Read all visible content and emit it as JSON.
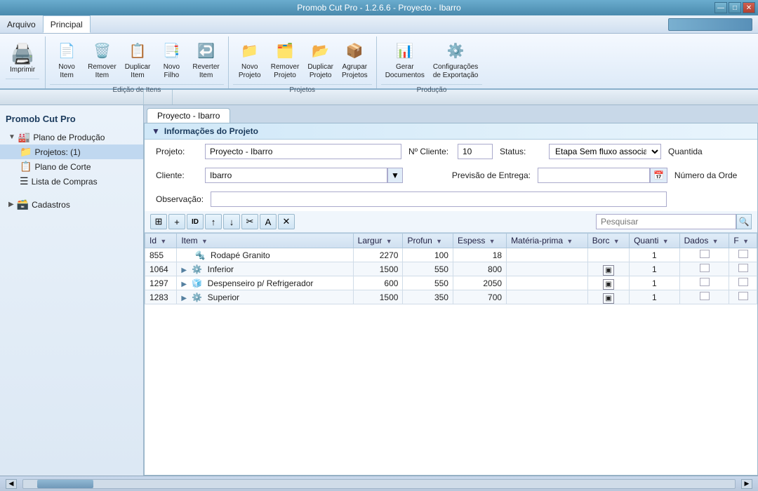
{
  "titleBar": {
    "title": "Promob Cut Pro - 1.2.6.6 - Proyecto - Ibarro",
    "controls": [
      "—",
      "□",
      "✕"
    ]
  },
  "menuBar": {
    "items": [
      "Arquivo",
      "Principal"
    ]
  },
  "ribbon": {
    "groups": [
      {
        "label": "",
        "items": [
          {
            "id": "imprimir",
            "icon": "🖨",
            "label": "Imprimir",
            "large": true
          }
        ]
      },
      {
        "label": "Edição de Itens",
        "items": [
          {
            "id": "novo-item",
            "icon": "📄",
            "label": "Novo\nItem"
          },
          {
            "id": "remover-item",
            "icon": "🗑",
            "label": "Remover\nItem"
          },
          {
            "id": "duplicar-item",
            "icon": "📋",
            "label": "Duplicar\nItem"
          },
          {
            "id": "novo-filho",
            "icon": "📑",
            "label": "Novo\nFilho"
          },
          {
            "id": "reverter-item",
            "icon": "↩",
            "label": "Reverter\nItem"
          }
        ]
      },
      {
        "label": "Projetos",
        "items": [
          {
            "id": "novo-projeto",
            "icon": "📁",
            "label": "Novo\nProjeto"
          },
          {
            "id": "remover-projeto",
            "icon": "🗂",
            "label": "Remover\nProjeto"
          },
          {
            "id": "duplicar-projeto",
            "icon": "📂",
            "label": "Duplicar\nProjeto"
          },
          {
            "id": "agrupar-projetos",
            "icon": "📦",
            "label": "Agrupar\nProjetos"
          }
        ]
      },
      {
        "label": "Produção",
        "items": [
          {
            "id": "gerar-documentos",
            "icon": "📊",
            "label": "Gerar\nDocumentos"
          },
          {
            "id": "config-exportacao",
            "icon": "⚙",
            "label": "Configurações\nde Exportação"
          }
        ]
      }
    ],
    "sectionLabels": [
      "",
      "Edição de Itens",
      "Projetos",
      "Produção"
    ]
  },
  "sidebar": {
    "title": "Promob Cut Pro",
    "items": [
      {
        "id": "plano-producao",
        "icon": "🏭",
        "label": "Plano de Produção",
        "expandable": true,
        "expanded": true
      },
      {
        "id": "projetos",
        "icon": "📁",
        "label": "Projetos: (1)",
        "child": true,
        "selected": true
      },
      {
        "id": "plano-corte",
        "icon": "📋",
        "label": "Plano de Corte",
        "child": true
      },
      {
        "id": "lista-compras",
        "icon": "☰",
        "label": "Lista de Compras",
        "child": true
      },
      {
        "id": "cadastros",
        "icon": "🗃",
        "label": "Cadastros",
        "expandable": true
      }
    ]
  },
  "tabs": [
    "Proyecto - Ibarro"
  ],
  "projectInfo": {
    "sectionTitle": "Informações do Projeto",
    "fields": {
      "projeto_label": "Projeto:",
      "projeto_value": "Proyecto - Ibarro",
      "nocliente_label": "Nº Cliente:",
      "nocliente_value": "10",
      "status_label": "Status:",
      "status_value": "Etapa Sem fluxo associa",
      "quantidade_label": "Quantida",
      "cliente_label": "Cliente:",
      "cliente_value": "Ibarro",
      "previsao_label": "Previsão de Entrega:",
      "previsao_value": "",
      "numeroordem_label": "Número da Orde",
      "observacao_label": "Observação:",
      "observacao_value": ""
    }
  },
  "toolbar": {
    "buttons": [
      "⊞",
      "+",
      "🆔",
      "↑",
      "↓",
      "✂",
      "A",
      "✕"
    ],
    "searchPlaceholder": "Pesquisar",
    "searchValue": ""
  },
  "table": {
    "columns": [
      {
        "id": "id",
        "label": "Id"
      },
      {
        "id": "item",
        "label": "Item"
      },
      {
        "id": "largura",
        "label": "Largur"
      },
      {
        "id": "profund",
        "label": "Profun"
      },
      {
        "id": "espess",
        "label": "Espess"
      },
      {
        "id": "materia",
        "label": "Matéria-prima"
      },
      {
        "id": "borcha",
        "label": "Borc"
      },
      {
        "id": "quanti",
        "label": "Quanti"
      },
      {
        "id": "dados",
        "label": "Dados"
      },
      {
        "id": "f",
        "label": "F"
      }
    ],
    "rows": [
      {
        "id": "855",
        "expandable": false,
        "icon": "🔩",
        "item": "Rodapé Granito",
        "largura": "2270",
        "profund": "100",
        "espess": "18",
        "materia": "",
        "borcha": "",
        "quanti": "1",
        "dados": "",
        "f": ""
      },
      {
        "id": "1064",
        "expandable": true,
        "icon": "⚙",
        "item": "Inferior",
        "largura": "1500",
        "profund": "550",
        "espess": "800",
        "materia": "",
        "borcha": "▣",
        "quanti": "1",
        "dados": "",
        "f": ""
      },
      {
        "id": "1297",
        "expandable": true,
        "icon": "🧊",
        "item": "Despenseiro p/ Refrigerador",
        "largura": "600",
        "profund": "550",
        "espess": "2050",
        "materia": "",
        "borcha": "▣",
        "quanti": "1",
        "dados": "",
        "f": ""
      },
      {
        "id": "1283",
        "expandable": true,
        "icon": "⚙",
        "item": "Superior",
        "largura": "1500",
        "profund": "350",
        "espess": "700",
        "materia": "",
        "borcha": "▣",
        "quanti": "1",
        "dados": "",
        "f": ""
      }
    ]
  },
  "statusBar": {
    "scrollLabel": ""
  },
  "icons": {
    "search": "🔍",
    "calendar": "📅",
    "collapse": "▼",
    "filter": "▼"
  }
}
